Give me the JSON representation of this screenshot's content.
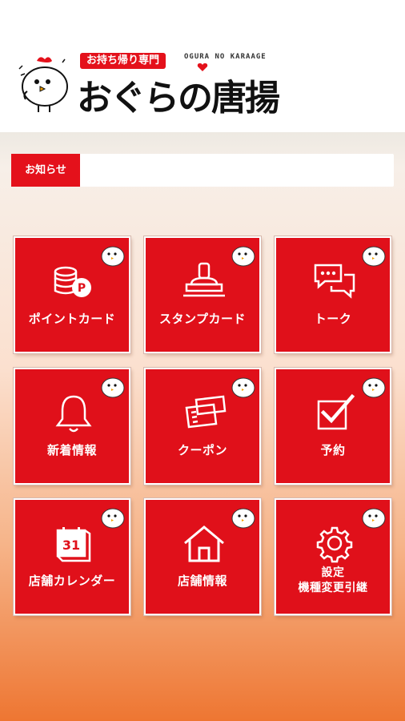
{
  "header": {
    "takeout_badge": "お持ち帰り専門",
    "roman_name": "OGURA NO KARAAGE",
    "brand_name": "おぐらの唐揚"
  },
  "notice": {
    "label": "お知らせ",
    "text": ""
  },
  "menu": [
    {
      "label": "ポイントカード",
      "icon": "point-card-icon"
    },
    {
      "label": "スタンプカード",
      "icon": "stamp-icon"
    },
    {
      "label": "トーク",
      "icon": "talk-icon"
    },
    {
      "label": "新着情報",
      "icon": "bell-icon"
    },
    {
      "label": "クーポン",
      "icon": "coupon-icon"
    },
    {
      "label": "予約",
      "icon": "reservation-check-icon"
    },
    {
      "label": "店舗カレンダー",
      "icon": "calendar-icon",
      "calendar_day": "31"
    },
    {
      "label": "店舗情報",
      "icon": "store-icon"
    },
    {
      "label_line1": "設定",
      "label_line2": "機種変更引継",
      "icon": "gear-icon"
    }
  ],
  "colors": {
    "accent": "#e0101a",
    "bottom_gradient": "#ee7632"
  }
}
